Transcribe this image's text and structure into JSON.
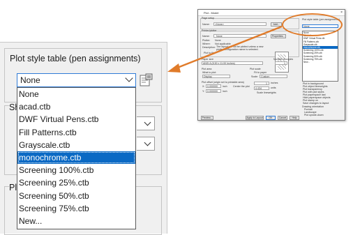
{
  "zoom": {
    "group_title": "Plot style table (pen assignments)",
    "selected_value": "None",
    "partial_labels": [
      "Sh",
      "Pl"
    ],
    "options": [
      "None",
      "acad.ctb",
      "DWF Virtual Pens.ctb",
      "Fill Patterns.ctb",
      "Grayscale.ctb",
      "monochrome.ctb",
      "Screening 100%.ctb",
      "Screening 25%.ctb",
      "Screening 50%.ctb",
      "Screening 75%.ctb",
      "New..."
    ],
    "highlighted_option": "monochrome.ctb",
    "edit_icon": "edit-plot-style-icon"
  },
  "mini_dialog": {
    "title": "Plot - Model",
    "close_glyph": "×",
    "page_setup_label": "Page setup",
    "page_setup_name_label": "Name:",
    "page_setup_name_value": "<None>",
    "add_button": "Add...",
    "printer_label": "Printer/plotter",
    "printer_name_label": "Name:",
    "printer_name_value": "None",
    "properties_button": "Properties...",
    "plotter_label": "Plotter:",
    "plotter_value": "None",
    "where_label": "Where:",
    "where_value": "Not applicable",
    "description_label": "Description:",
    "description_value": "The layout will not be plotted unless a new plotter configuration name is selected.",
    "plot_to_file_label": "Plot to file",
    "paper_size_label": "Paper size",
    "paper_size_value": "ANSI A (8.50 x 11.00 Inches)",
    "copies_label": "Number of copies",
    "copies_value": "1",
    "plot_area_label": "Plot area",
    "what_to_plot_label": "What to plot:",
    "what_to_plot_value": "Display",
    "plot_scale_label": "Plot scale",
    "fit_to_paper_label": "Fit to paper",
    "scale_label": "Scale:",
    "scale_value": "Custom",
    "plot_offset_label": "Plot offset (origin set to printable area)",
    "x_label": "X:",
    "x_value": "0.000000",
    "y_label": "Y:",
    "y_value": "0.000000",
    "inch_label": "inch",
    "center_plot_label": "Center the plot",
    "scale_num_value": "1",
    "scale_den_value": "4.434",
    "inches_label": "inches",
    "units_label": "units",
    "scale_lineweights_label": "Scale lineweights",
    "pst_label": "Plot style table (pen assignments)",
    "pst_value": "None",
    "pst_list": [
      "None",
      "acad.ctb",
      "DWF Virtual Pens.ctb",
      "Fill Patterns.ctb",
      "Grayscale.ctb",
      "monochrome.ctb",
      "Screening 100%.ctb",
      "Screening 25%.ctb",
      "Screening 50%.ctb",
      "Screening 75%.ctb",
      "New..."
    ],
    "options_list": [
      "Plot in background",
      "Plot object lineweights",
      "Plot transparency",
      "Plot with plot styles",
      "Plot paperspace last",
      "Hide paperspace objects",
      "Plot stamp on",
      "Save changes to layout"
    ],
    "orientation_label": "Drawing orientation",
    "portrait_label": "Portrait",
    "landscape_label": "Landscape",
    "upside_down_label": "Plot upside-down",
    "preview_button": "Preview...",
    "apply_button": "Apply to Layout",
    "ok_button": "OK",
    "cancel_button": "Cancel",
    "help_button": "Help"
  },
  "colors": {
    "callout": "#e07b2a",
    "selection": "#0a69c4",
    "focus_border": "#2f7bd6"
  }
}
